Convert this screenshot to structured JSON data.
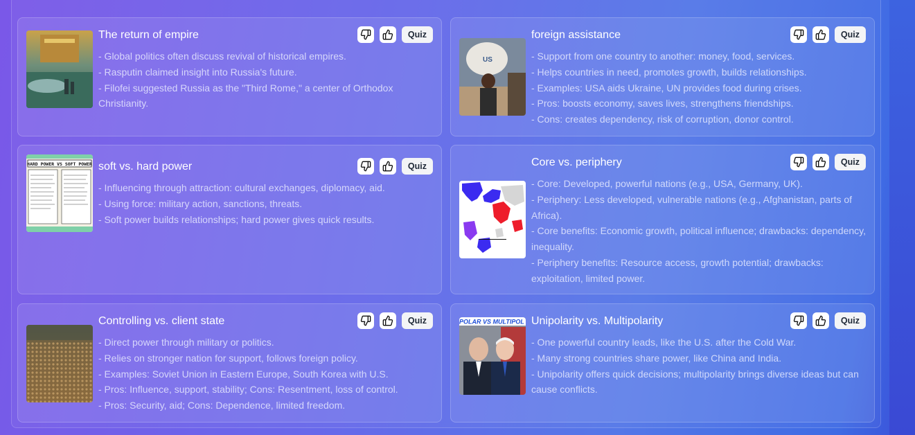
{
  "cards": [
    {
      "title": "The return of empire",
      "image": "fantasy-castle-landscape",
      "bullets": [
        "- Global politics often discuss revival of historical empires.",
        "- Rasputin claimed insight into Russia's future.",
        "- Filofei suggested Russia as the \"Third Rome,\" a center of Orthodox Christianity."
      ]
    },
    {
      "title": "foreign assistance",
      "image": "child-carrying-usaid-bag",
      "bullets": [
        "- Support from one country to another: money, food, services.",
        "- Helps countries in need, promotes growth, builds relationships.",
        "- Examples: USA aids Ukraine, UN provides food during crises.",
        "- Pros: boosts economy, saves lives, strengthens friendships.",
        "- Cons: creates dependency, risk of corruption, donor control."
      ]
    },
    {
      "title": "soft vs. hard power",
      "image": "hard-power-vs-soft-power-poster",
      "image_text": "HARD POWER VS SOFT POWER",
      "bullets": [
        "- Influencing through attraction: cultural exchanges, diplomacy, aid.",
        "- Using force: military action, sanctions, threats.",
        "- Soft power builds relationships; hard power gives quick results."
      ]
    },
    {
      "title": "Core vs. periphery",
      "image": "world-map-core-periphery",
      "bullets": [
        "- Core: Developed, powerful nations (e.g., USA, Germany, UK).",
        "- Periphery: Less developed, vulnerable nations (e.g., Afghanistan, parts of Africa).",
        "- Core benefits: Economic growth, political influence; drawbacks: dependency, inequality.",
        "- Periphery benefits: Resource access, growth potential; drawbacks: exploitation, limited power."
      ]
    },
    {
      "title": "Controlling vs. client state",
      "image": "crowd-of-soldiers",
      "bullets": [
        "- Direct power through military or politics.",
        "- Relies on stronger nation for support, follows foreign policy.",
        "- Examples: Soviet Union in Eastern Europe, South Korea with U.S.",
        "- Pros: Influence, support, stability; Cons: Resentment, loss of control.",
        "- Pros: Security, aid; Cons: Dependence, limited freedom."
      ]
    },
    {
      "title": "Unipolarity vs. Multipolarity",
      "image": "two-leaders-unipolar-vs-multipolar",
      "image_text": "POLAR VS MULTIPOL",
      "bullets": [
        "- One powerful country leads, like the U.S. after the Cold War.",
        "- Many strong countries share power, like China and India.",
        "- Unipolarity offers quick decisions; multipolarity brings diverse ideas but can cause conflicts."
      ]
    }
  ],
  "buttons": {
    "dislike_icon": "thumbs-down-icon",
    "like_icon": "thumbs-up-icon",
    "quiz_label": "Quiz"
  }
}
